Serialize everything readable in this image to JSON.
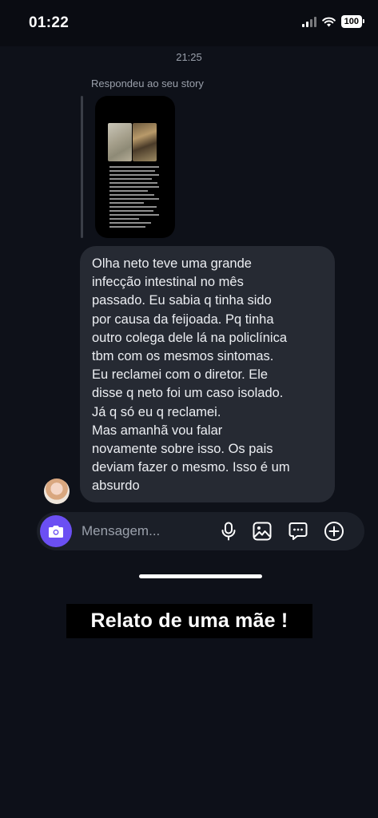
{
  "status_bar": {
    "time": "01:22",
    "battery": "100"
  },
  "chat": {
    "timestamp": "21:25",
    "reply_label": "Respondeu ao seu story",
    "message": "Olha neto teve uma grande\ninfecção intestinal no mês\npassado. Eu sabia q tinha sido\npor causa da feijoada. Pq tinha\noutro colega dele lá na policlínica\ntbm com os mesmos sintomas.\nEu reclamei com o diretor. Ele\ndisse q neto foi um caso isolado.\nJá q só eu q reclamei.\nMas amanhã vou falar\nnovamente sobre isso. Os pais\ndeviam fazer o mesmo. Isso é um\nabsurdo"
  },
  "composer": {
    "placeholder": "Mensagem...",
    "icons": [
      "camera-icon",
      "microphone-icon",
      "gallery-icon",
      "sticker-icon",
      "add-icon"
    ],
    "accent_color": "#6b4ff3"
  },
  "caption": "Relato de uma mãe !"
}
